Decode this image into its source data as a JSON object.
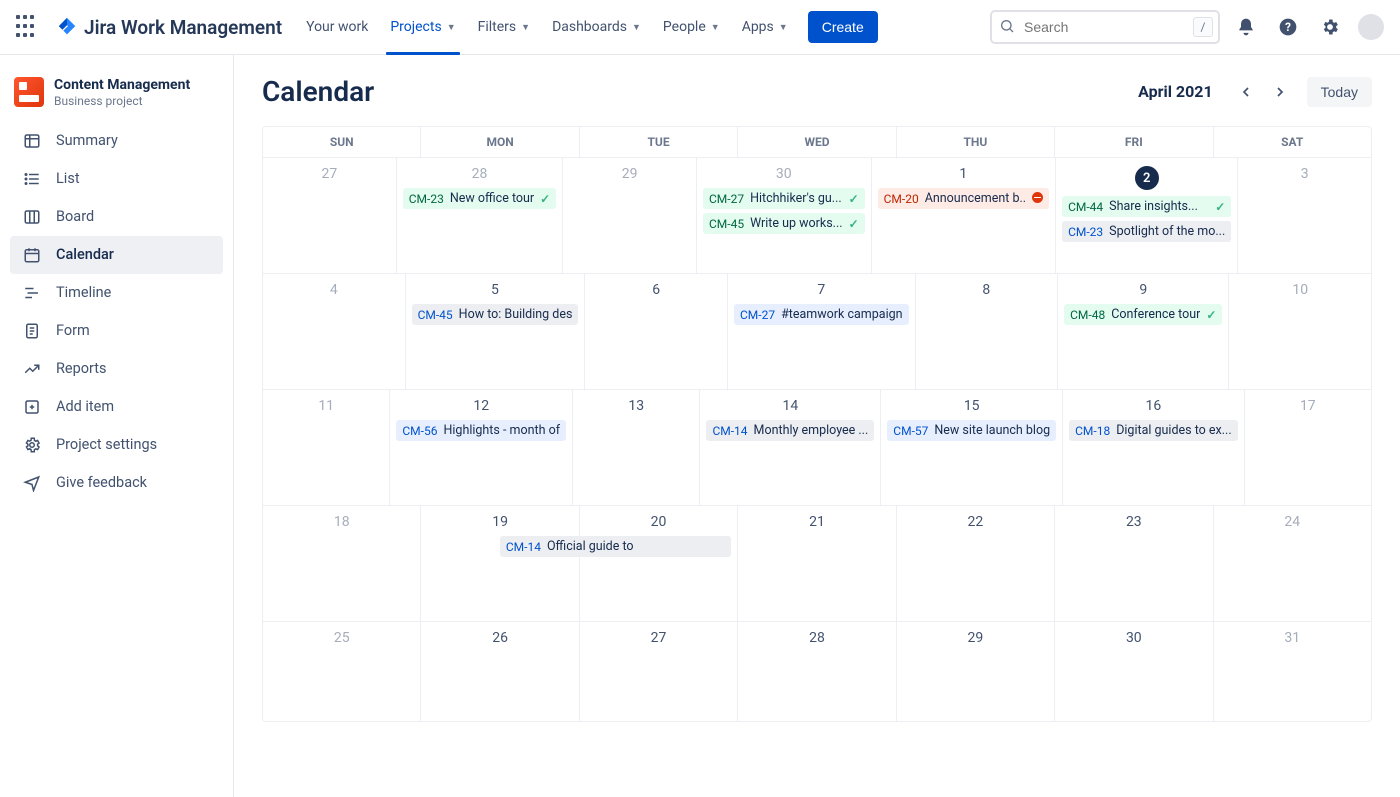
{
  "brand": "Jira Work Management",
  "nav": {
    "yourwork": "Your work",
    "projects": "Projects",
    "filters": "Filters",
    "dashboards": "Dashboards",
    "people": "People",
    "apps": "Apps",
    "create": "Create"
  },
  "search": {
    "placeholder": "Search",
    "shortcut": "/"
  },
  "project": {
    "name": "Content Management",
    "type": "Business project"
  },
  "sidebar": {
    "summary": "Summary",
    "list": "List",
    "board": "Board",
    "calendar": "Calendar",
    "timeline": "Timeline",
    "form": "Form",
    "reports": "Reports",
    "additem": "Add item",
    "settings": "Project settings",
    "feedback": "Give feedback"
  },
  "calendar": {
    "title": "Calendar",
    "month": "April 2021",
    "today": "Today",
    "dow": {
      "sun": "SUN",
      "mon": "MON",
      "tue": "TUE",
      "wed": "WED",
      "thu": "THU",
      "fri": "FRI",
      "sat": "SAT"
    },
    "days": {
      "w1": {
        "sun": "27",
        "mon": "28",
        "tue": "29",
        "wed": "30",
        "thu": "1",
        "fri": "2",
        "sat": "3"
      },
      "w2": {
        "sun": "4",
        "mon": "5",
        "tue": "6",
        "wed": "7",
        "thu": "8",
        "fri": "9",
        "sat": "10"
      },
      "w3": {
        "sun": "11",
        "mon": "12",
        "tue": "13",
        "wed": "14",
        "thu": "15",
        "fri": "16",
        "sat": "17"
      },
      "w4": {
        "sun": "18",
        "mon": "19",
        "tue": "20",
        "wed": "21",
        "thu": "22",
        "fri": "23",
        "sat": "24"
      },
      "w5": {
        "sun": "25",
        "mon": "26",
        "tue": "27",
        "wed": "28",
        "thu": "29",
        "fri": "30",
        "sat": "31"
      }
    },
    "events": {
      "e1": {
        "key": "CM-23",
        "title": "New office tour"
      },
      "e2": {
        "key": "CM-27",
        "title": "Hitchhiker's gu..."
      },
      "e3": {
        "key": "CM-45",
        "title": "Write up works..."
      },
      "e4": {
        "key": "CM-20",
        "title": "Announcement b.."
      },
      "e5": {
        "key": "CM-44",
        "title": "Share insights..."
      },
      "e6": {
        "key": "CM-23",
        "title": "Spotlight of the mo..."
      },
      "e7": {
        "key": "CM-45",
        "title": "How to: Building des"
      },
      "e8": {
        "key": "CM-27",
        "title": "#teamwork campaign"
      },
      "e9": {
        "key": "CM-48",
        "title": "Conference tour"
      },
      "e10": {
        "key": "CM-56",
        "title": "Highlights - month of"
      },
      "e11": {
        "key": "CM-14",
        "title": "Monthly employee ..."
      },
      "e12": {
        "key": "CM-57",
        "title": "New site launch blog"
      },
      "e13": {
        "key": "CM-18",
        "title": "Digital guides to ex..."
      },
      "e14": {
        "key": "CM-14",
        "title": "Official guide to"
      }
    }
  }
}
